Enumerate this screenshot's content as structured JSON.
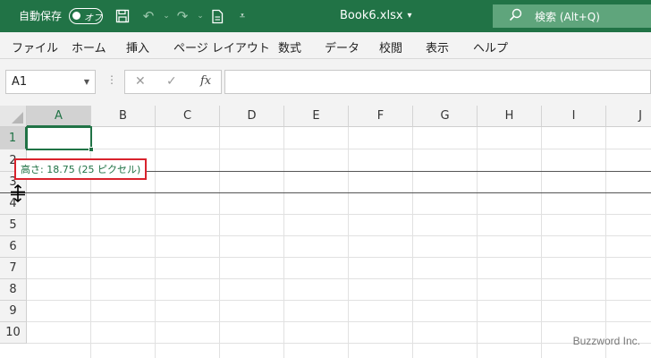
{
  "titlebar": {
    "autosave_label": "自動保存",
    "autosave_state": "オフ",
    "document_title": "Book6.xlsx",
    "search_text": "検索 (Alt+Q)",
    "icons": [
      "save-icon",
      "undo-icon",
      "redo-icon",
      "document-icon",
      "customize-arrow-icon"
    ]
  },
  "ribbon": {
    "tabs": [
      "ファイル",
      "ホーム",
      "挿入",
      "ページ レイアウト",
      "数式",
      "データ",
      "校閲",
      "表示",
      "ヘルプ"
    ]
  },
  "formula_bar": {
    "name_box": "A1",
    "fx_label": "fx",
    "formula": ""
  },
  "sheet": {
    "columns": [
      "A",
      "B",
      "C",
      "D",
      "E",
      "F",
      "G",
      "H",
      "I",
      "J"
    ],
    "rows": [
      "1",
      "2",
      "3",
      "4",
      "5",
      "6",
      "7",
      "8",
      "9",
      "10"
    ],
    "active_column": "A",
    "active_row": "1",
    "tooltip": "高さ: 18.75 (25 ピクセル)"
  },
  "watermark": "Buzzword Inc.",
  "colors": {
    "accent": "#217346",
    "tooltip_border": "#d9232d"
  }
}
